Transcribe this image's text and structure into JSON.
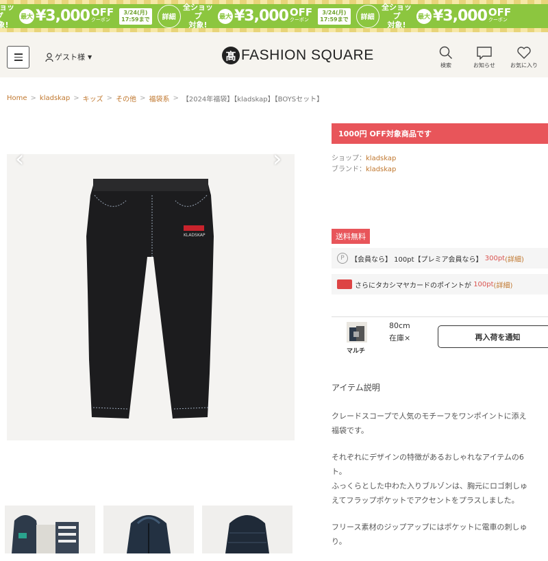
{
  "banner": {
    "shop_line1": "全ショップ",
    "shop_line2": "対象!",
    "max": "最大",
    "amount": "¥3,000",
    "off": "OFF",
    "coupon": "クーポン",
    "date_line1": "3/24(月)",
    "date_line2": "17:59まで",
    "detail": "詳細"
  },
  "header": {
    "guest_label": "ゲスト様",
    "logo_mark": "髙",
    "logo_text": "FASHION SQUARE",
    "search_label": "検索",
    "notice_label": "お知らせ",
    "favorite_label": "お気に入り"
  },
  "breadcrumb": {
    "items": [
      "Home",
      "kladskap",
      "キッズ",
      "その他",
      "福袋系"
    ],
    "current": "【2024年福袋】【kladskap】【BOYSセット】"
  },
  "product": {
    "off_badge": "1000円 OFF対象商品です",
    "shop_label": "ショップ：",
    "shop_value": "kladskap",
    "brand_label": "ブランド：",
    "brand_value": "kladskap",
    "free_shipping": "送料無料",
    "points_prefix": "【会員なら】 100pt【プレミア会員なら】",
    "points_premium": "300pt",
    "points_detail": "(詳細)",
    "card_prefix": "さらにタカシマヤカードのポイントが",
    "card_points": "100pt",
    "card_detail": "(詳細)",
    "color_name": "マルチ",
    "size": "80cm",
    "stock": "在庫×",
    "notify_button": "再入荷を通知",
    "image_brand_mark": "KLADSKAP"
  },
  "description": {
    "title": "アイテム説明",
    "p1_l1": "クレードスコープで人気のモチーフをワンポイントに添え",
    "p1_l2": "福袋です。",
    "p2_l1": "それぞれにデザインの特徴があるおしゃれなアイテムの6",
    "p2_l2": "ト。",
    "p2_l3": "ふっくらとした中わた入りブルゾンは、胸元にロゴ刺しゅ",
    "p2_l4": "えてフラップポケットでアクセントをプラスしました。",
    "p3_l1": "フリース素材のジップアップにはポケットに電車の刺しゅ",
    "p3_l2": "り。"
  },
  "colors": {
    "banner_green": "#8cc63f",
    "accent_red": "#e8555a",
    "link_brown": "#c0772e"
  }
}
